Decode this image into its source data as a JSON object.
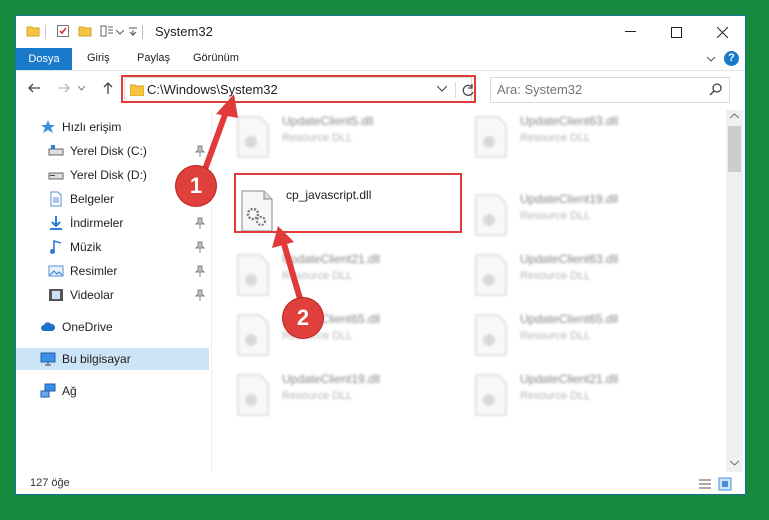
{
  "window": {
    "title": "System32",
    "controls": {
      "minimize": "minimize-icon",
      "maximize": "maximize-icon",
      "close": "close-icon"
    }
  },
  "ribbon": {
    "tabs": [
      "Dosya",
      "Giriş",
      "Paylaş",
      "Görünüm"
    ],
    "active_tab": "Dosya",
    "accent_color": "#1979ca",
    "help": "?"
  },
  "address_bar": {
    "path": "C:\\Windows\\System32"
  },
  "search": {
    "placeholder": "Ara: System32"
  },
  "sidebar": {
    "quick_access": "Hızlı erişim",
    "items": [
      {
        "label": "Yerel Disk (C:)",
        "icon": "drive-icon",
        "pinned": true
      },
      {
        "label": "Yerel Disk (D:)",
        "icon": "drive-icon",
        "pinned": false
      },
      {
        "label": "Belgeler",
        "icon": "documents-icon",
        "pinned": true
      },
      {
        "label": "İndirmeler",
        "icon": "downloads-icon",
        "pinned": true
      },
      {
        "label": "Müzik",
        "icon": "music-icon",
        "pinned": true
      },
      {
        "label": "Resimler",
        "icon": "pictures-icon",
        "pinned": true
      },
      {
        "label": "Videolar",
        "icon": "videos-icon",
        "pinned": true
      }
    ],
    "onedrive": "OneDrive",
    "this_pc": "Bu bilgisayar",
    "network": "Ağ",
    "selected": "Bu bilgisayar"
  },
  "files": {
    "highlighted": {
      "name": "cp_javascript.dll",
      "type": ""
    },
    "blurred_left": [
      {
        "name": "UpdateClient5.dll",
        "type": "Resource DLL"
      },
      {
        "name": "UpdateClient21.dll",
        "type": "Resource DLL"
      },
      {
        "name": "UpdateClient65.dll",
        "type": "Resource DLL"
      },
      {
        "name": "UpdateClient19.dll",
        "type": "Resource DLL"
      }
    ],
    "blurred_right": [
      {
        "name": "UpdateClient63.dll",
        "type": "Resource DLL"
      },
      {
        "name": "UpdateClient19.dll",
        "type": "Resource DLL"
      },
      {
        "name": "UpdateClient63.dll",
        "type": "Resource DLL"
      },
      {
        "name": "UpdateClient65.dll",
        "type": "Resource DLL"
      },
      {
        "name": "UpdateClient21.dll",
        "type": "Resource DLL"
      }
    ]
  },
  "status": {
    "count": "127 öğe"
  },
  "annotations": {
    "color": "#e03a3a",
    "step1": "1",
    "step2": "2"
  },
  "desktop_color": "#168a3e"
}
